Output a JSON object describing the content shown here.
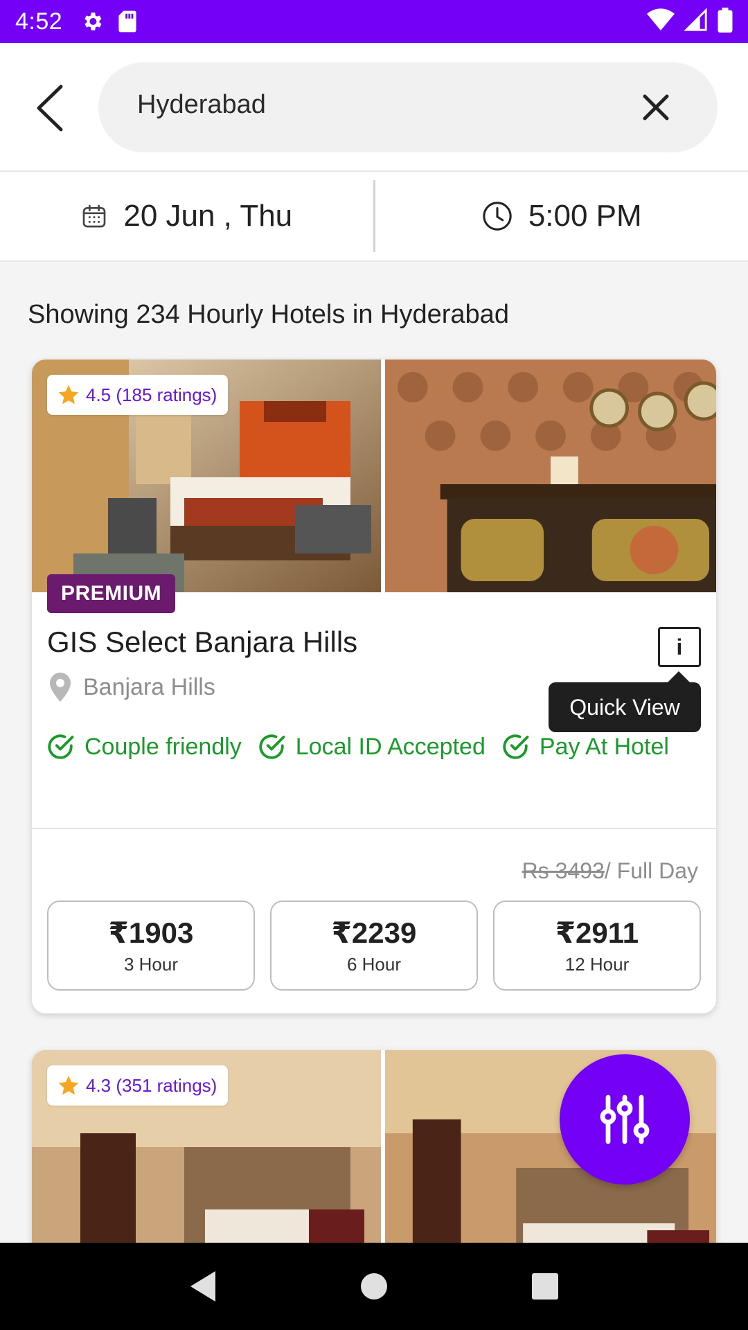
{
  "status_bar": {
    "time": "4:52",
    "icons": [
      "settings-icon",
      "sd-card-icon",
      "wifi-icon",
      "signal-icon",
      "battery-icon"
    ]
  },
  "search": {
    "query": "Hyderabad",
    "back_icon": "back-arrow-icon",
    "clear_icon": "close-icon"
  },
  "date_time": {
    "date": "20 Jun , Thu",
    "time": "5:00 PM"
  },
  "results": {
    "summary": "Showing 234 Hourly Hotels in Hyderabad"
  },
  "hotels": [
    {
      "rating": "4.5 (185 ratings)",
      "badge": "PREMIUM",
      "name": "GIS Select Banjara Hills",
      "location": "Banjara Hills",
      "info_button": "i",
      "tooltip": "Quick View",
      "features": [
        "Couple friendly",
        "Local ID Accepted",
        "Pay At Hotel"
      ],
      "original_price": "Rs 3493",
      "price_suffix": "/ Full Day",
      "prices": [
        {
          "amount": "₹1903",
          "duration": "3 Hour"
        },
        {
          "amount": "₹2239",
          "duration": "6 Hour"
        },
        {
          "amount": "₹2911",
          "duration": "12 Hour"
        }
      ]
    },
    {
      "rating": "4.3 (351 ratings)"
    }
  ],
  "fab": {
    "icon": "filter-sliders-icon"
  },
  "colors": {
    "brand": "#7400f5",
    "rating_text": "#6a16d6",
    "premium": "#6b1a6e",
    "feature_green": "#1b9a2c",
    "star": "#f5a623"
  }
}
